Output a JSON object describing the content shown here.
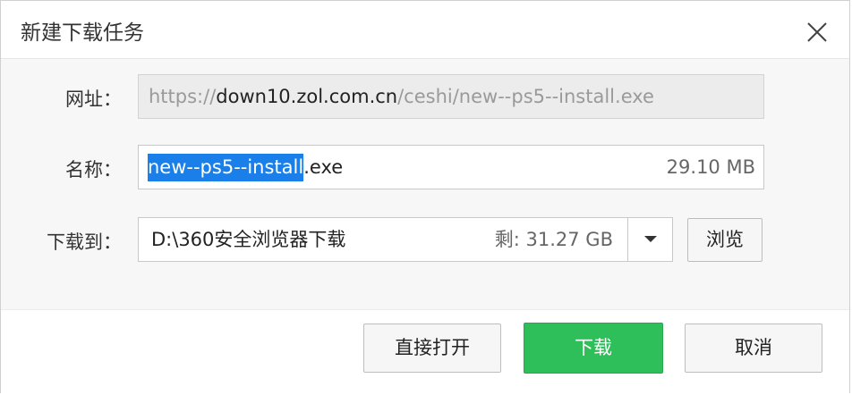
{
  "dialog": {
    "title": "新建下载任务"
  },
  "url": {
    "label": "网址：",
    "scheme": "https://",
    "host": "down10.zol.com.cn",
    "path": "/ceshi/new--ps5--install.exe"
  },
  "name": {
    "label": "名称：",
    "selected_part": "new--ps5--install",
    "extension": ".exe",
    "size": "29.10 MB"
  },
  "save_to": {
    "label": "下载到：",
    "path": "D:\\360安全浏览器下载",
    "free_space": "剩: 31.27 GB",
    "browse_label": "浏览"
  },
  "buttons": {
    "open_directly": "直接打开",
    "download": "下载",
    "cancel": "取消"
  },
  "colors": {
    "download_button": "#2fbf5a",
    "selection": "#1a7fe8"
  },
  "icons": {
    "close": "close-icon",
    "dropdown": "chevron-down-icon"
  }
}
